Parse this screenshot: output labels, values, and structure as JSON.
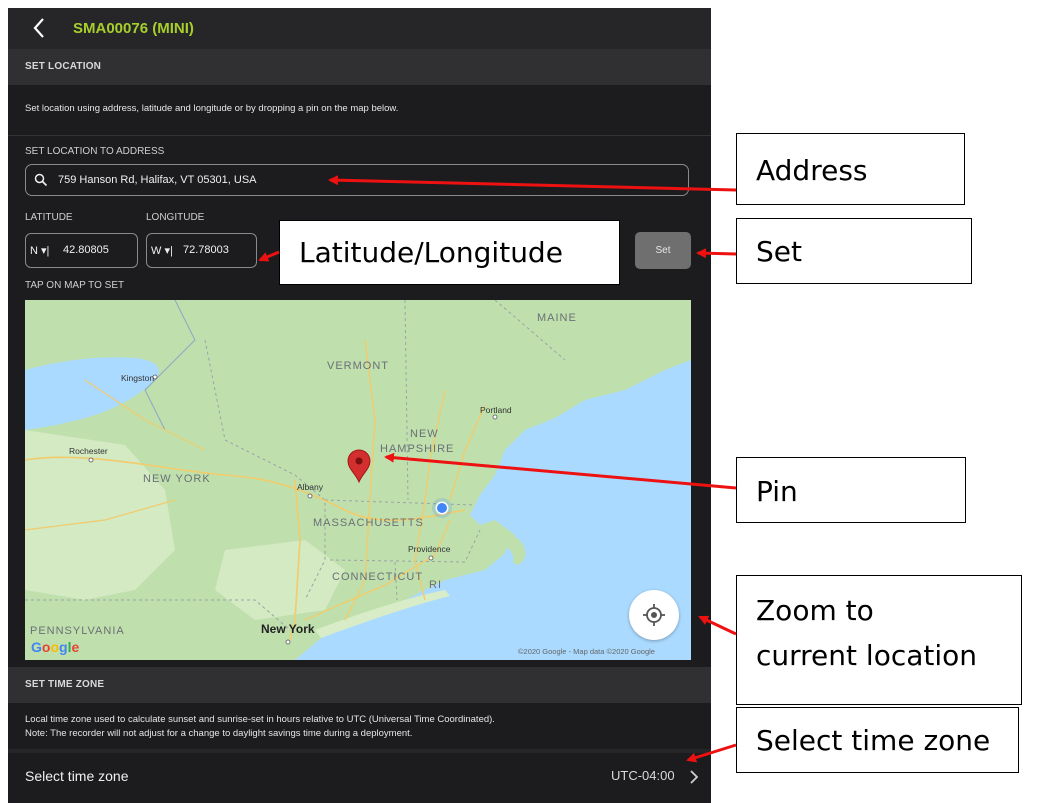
{
  "header": {
    "title": "SMA00076 (MINI)"
  },
  "set_location": {
    "heading": "SET LOCATION",
    "description": "Set location using address, latitude and longitude or by dropping a pin on the map below.",
    "address_label": "SET LOCATION TO ADDRESS",
    "address_value": "759 Hanson Rd, Halifax, VT 05301, USA",
    "latitude_label": "LATITUDE",
    "longitude_label": "LONGITUDE",
    "lat_dir": "N",
    "lat_value": "42.80805",
    "lon_dir": "W",
    "lon_value": "72.78003",
    "set_button": "Set",
    "tap_map_label": "TAP ON MAP TO SET"
  },
  "map": {
    "labels": [
      "MAINE",
      "VERMONT",
      "NEW",
      "HAMPSHIRE",
      "NEW YORK",
      "MASSACHUSETTS",
      "CONNECTICUT",
      "RI",
      "PENNSYLVANIA"
    ],
    "cities": [
      "Kingston",
      "Portland",
      "Rochester",
      "Albany",
      "Providence",
      "New York"
    ],
    "google_logo": "Google",
    "credit": "©2020 Google - Map data ©2020 Google"
  },
  "time_zone": {
    "heading": "SET TIME ZONE",
    "description_1": "Local time zone used to calculate sunset and sunrise-set in hours relative to UTC (Universal Time Coordinated).",
    "description_2": "Note: The recorder will not adjust for a change to daylight savings time during a deployment.",
    "row_label": "Select time zone",
    "row_value": "UTC-04:00"
  },
  "callouts": {
    "address": "Address",
    "latlon": "Latitude/Longitude",
    "set": "Set",
    "pin": "Pin",
    "zoom_1": "Zoom to",
    "zoom_2": "current location",
    "timezone": "Select time zone"
  },
  "colors": {
    "accent": "#a6cf2c",
    "background": "#1c1c1e",
    "water": "#aadaff",
    "land": "#bfe0ad",
    "pin": "#d32f2f",
    "arrow": "#ee1111"
  }
}
